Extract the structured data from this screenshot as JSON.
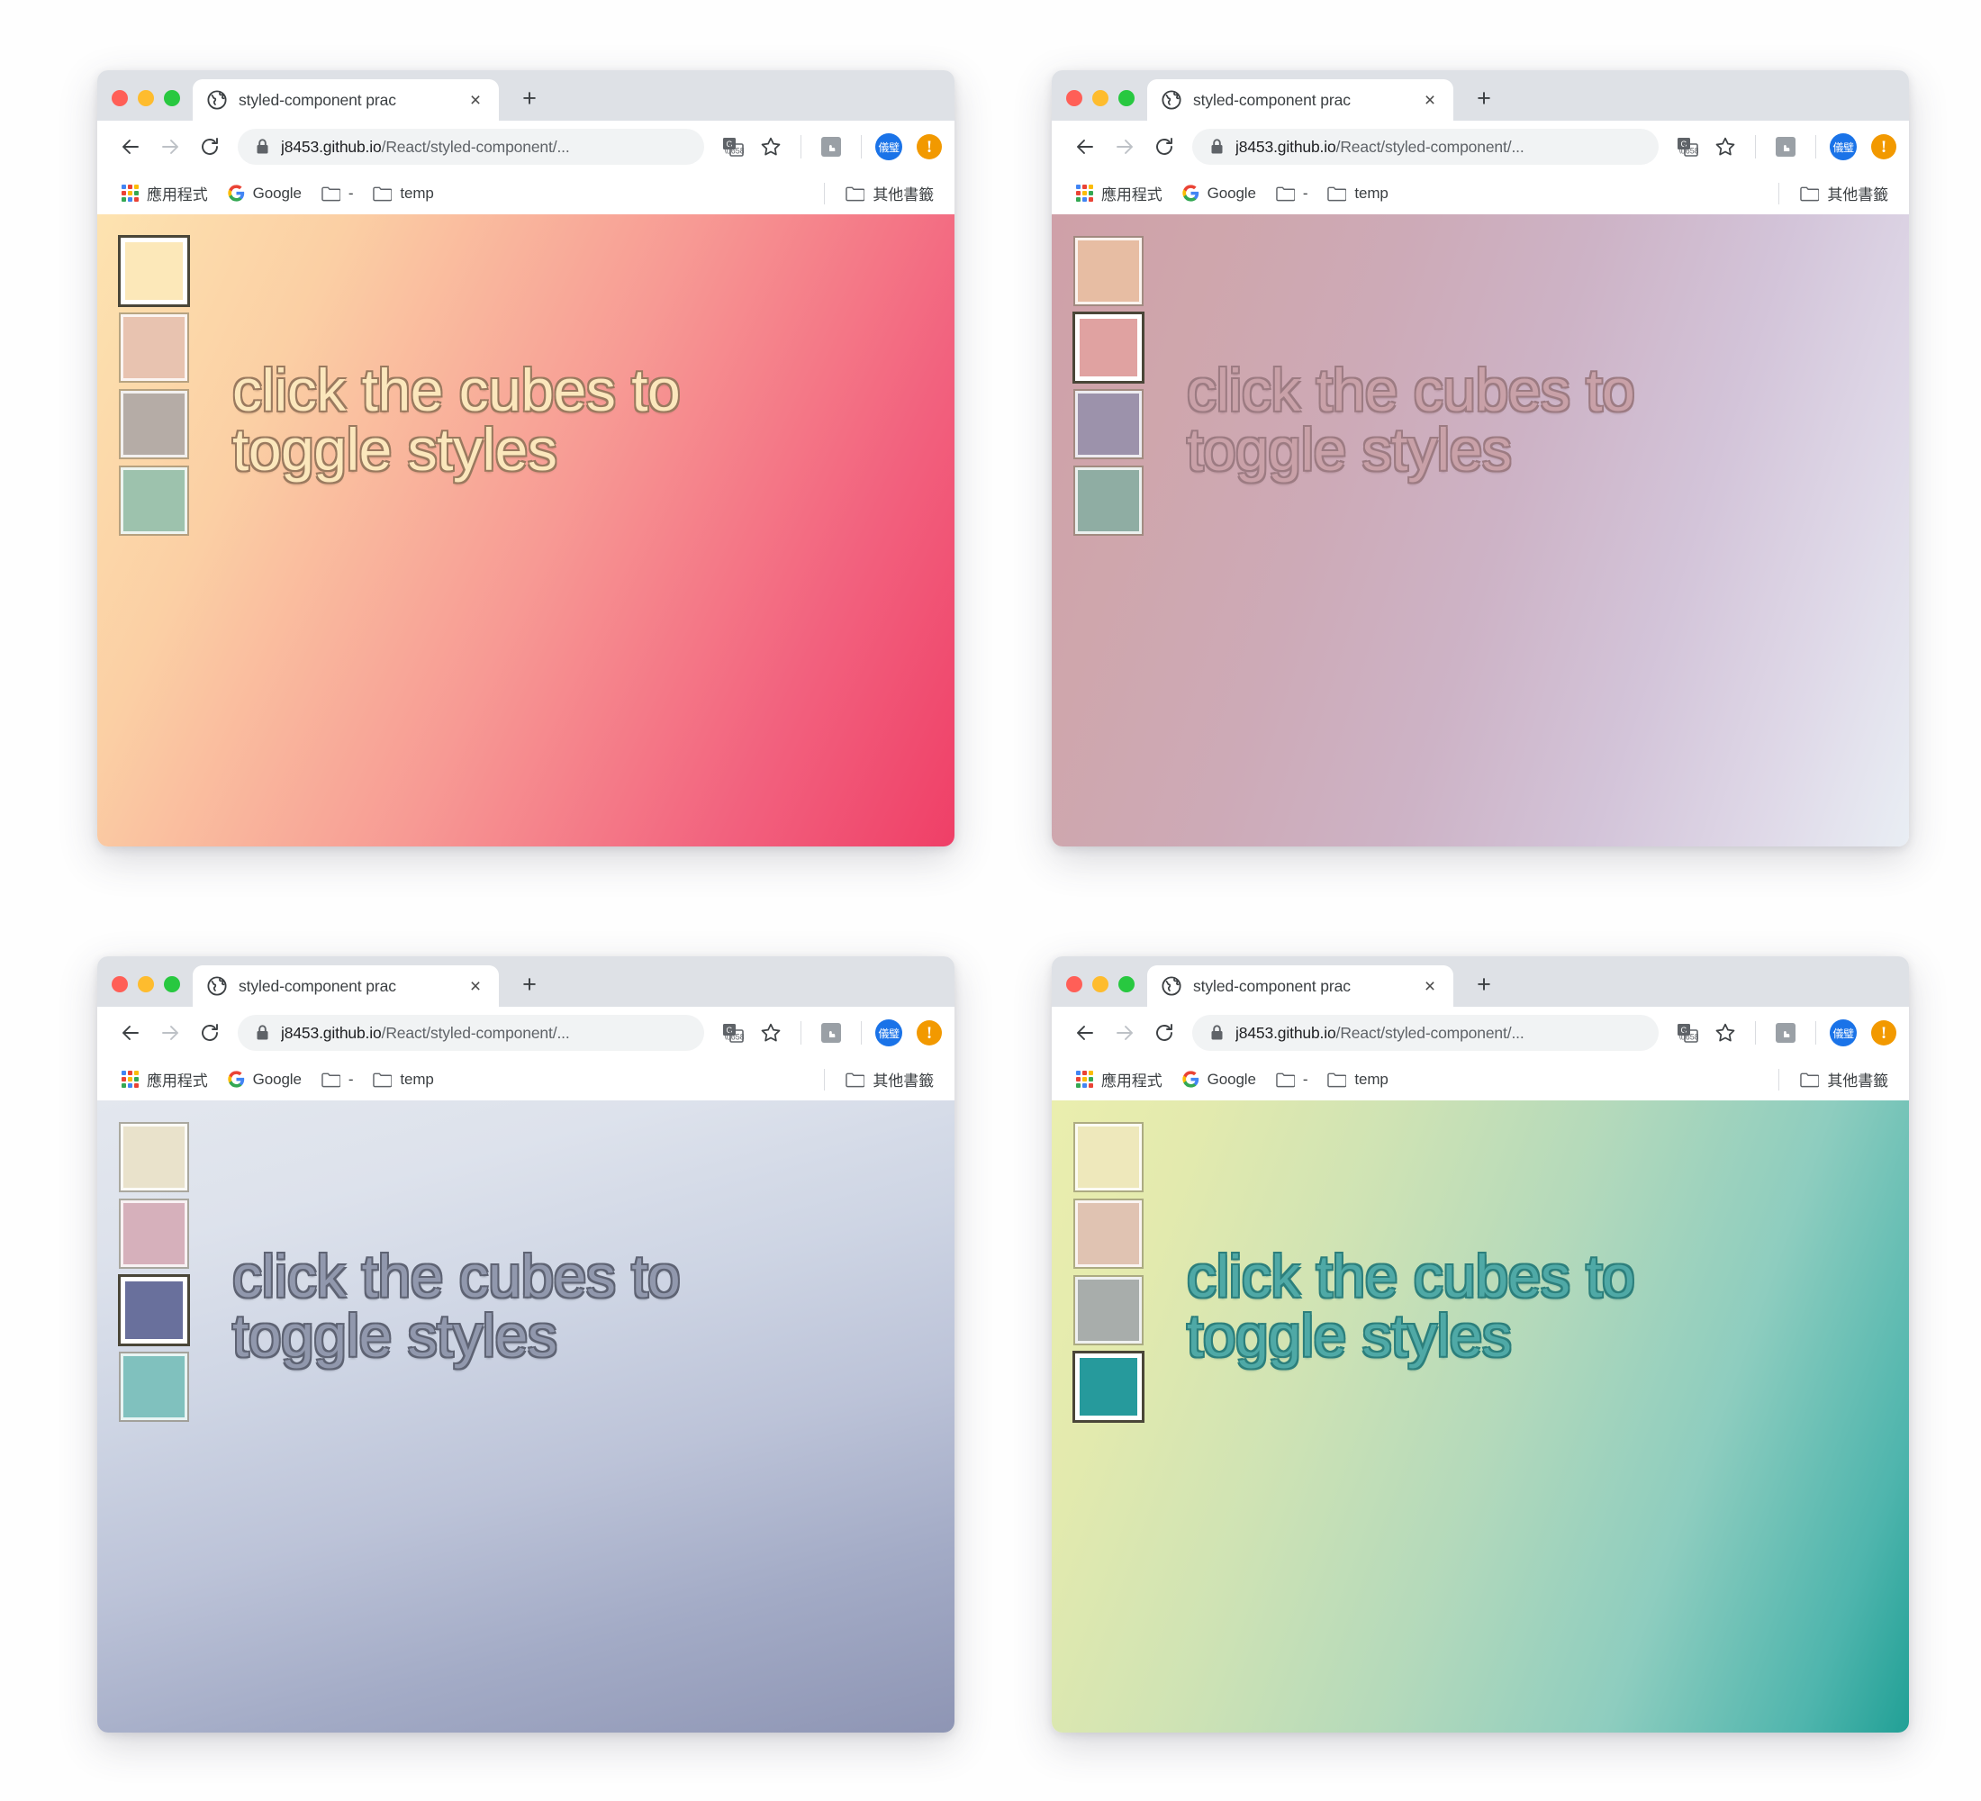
{
  "browser": {
    "tab": {
      "title": "styled-component prac",
      "favicon": "globe-icon",
      "close": "×",
      "newtab": "+"
    },
    "toolbar": {
      "back": "←",
      "forward": "→",
      "reload": "↻",
      "lock": "lock-icon",
      "url_host": "j8453.github.io",
      "url_path": "/React/styled-component/...",
      "translate": "translate-icon",
      "bookmark_star": "☆",
      "extension": "extension-icon",
      "avatar_label": "儀璧",
      "update_alert": "!"
    },
    "bookmarks": [
      {
        "icon": "apps-grid-icon",
        "label": "應用程式"
      },
      {
        "icon": "google-icon",
        "label": "Google"
      },
      {
        "icon": "folder-icon",
        "label": "-"
      },
      {
        "icon": "folder-icon",
        "label": "temp"
      }
    ],
    "bookmarks_right": {
      "icon": "folder-icon",
      "label": "其他書籤"
    }
  },
  "page": {
    "heading_line1": "click the cubes to",
    "heading_line2": "toggle styles"
  },
  "windows": [
    {
      "id": "window-top-left",
      "theme": "warm-red",
      "gradient": [
        "#fde3b0",
        "#ef3f67"
      ],
      "heading_color": "#fbe7bc",
      "heading_outline": "#9a7a5f",
      "cubes": [
        {
          "name": "cube-cream",
          "color": "#fce8b9",
          "selected": true
        },
        {
          "name": "cube-blush",
          "color": "#e8c3b0",
          "selected": false
        },
        {
          "name": "cube-taupe",
          "color": "#b5aca6",
          "selected": false
        },
        {
          "name": "cube-sage",
          "color": "#9dc2ad",
          "selected": false
        }
      ]
    },
    {
      "id": "window-top-right",
      "theme": "mauve-lilac",
      "gradient": [
        "#cfa0a8",
        "#e9eef4"
      ],
      "heading_color": "#c9a1a8",
      "heading_outline": "#9c7b82",
      "cubes": [
        {
          "name": "cube-peach",
          "color": "#e7bda3",
          "selected": false
        },
        {
          "name": "cube-rose",
          "color": "#e0a2a1",
          "selected": true
        },
        {
          "name": "cube-violet",
          "color": "#9c92ab",
          "selected": false
        },
        {
          "name": "cube-sage",
          "color": "#8fada3",
          "selected": false
        }
      ]
    },
    {
      "id": "window-bottom-left",
      "theme": "cool-slate",
      "gradient": [
        "#e3e7ee",
        "#8e95b4"
      ],
      "heading_color": "#9198ad",
      "heading_outline": "#5e6373",
      "cubes": [
        {
          "name": "cube-ivory",
          "color": "#e9e2cb",
          "selected": false
        },
        {
          "name": "cube-pink",
          "color": "#d6b0bb",
          "selected": false
        },
        {
          "name": "cube-indigo",
          "color": "#69709c",
          "selected": true
        },
        {
          "name": "cube-teal",
          "color": "#80c1be",
          "selected": false
        }
      ]
    },
    {
      "id": "window-bottom-right",
      "theme": "lime-teal",
      "gradient": [
        "#eaeeae",
        "#21a096"
      ],
      "heading_color": "#4fa9a6",
      "heading_outline": "#2c7f7c",
      "cubes": [
        {
          "name": "cube-butter",
          "color": "#eee8bb",
          "selected": false
        },
        {
          "name": "cube-sand",
          "color": "#e0c3b2",
          "selected": false
        },
        {
          "name": "cube-stone",
          "color": "#a8adab",
          "selected": false
        },
        {
          "name": "cube-teal",
          "color": "#269a9c",
          "selected": true
        }
      ]
    }
  ]
}
